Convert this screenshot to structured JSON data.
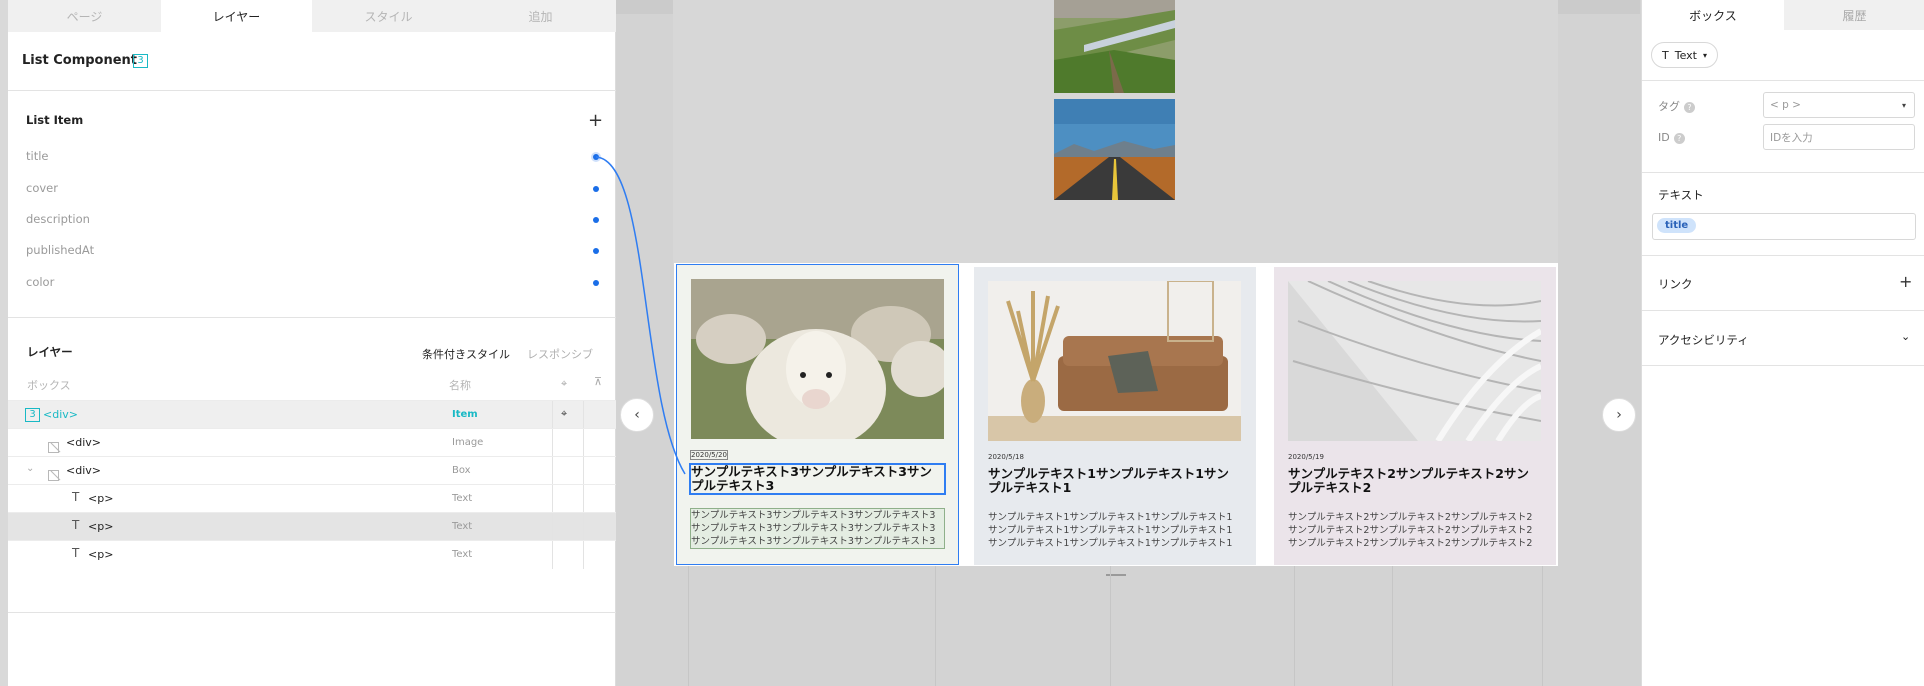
{
  "left_panel": {
    "tabs": [
      "ページ",
      "レイヤー",
      "スタイル",
      "追加"
    ],
    "component_title": "List Component",
    "component_badge": "3",
    "list_item_heading": "List Item",
    "fields": [
      "title",
      "cover",
      "description",
      "publishedAt",
      "color"
    ],
    "layers_heading": "レイヤー",
    "conditional_style": "条件付きスタイル",
    "responsive": "レスポンシブ",
    "col_box": "ボックス",
    "col_name": "名称",
    "layers": [
      {
        "badge": "3",
        "tag": "<div>",
        "type": "Item",
        "icon": "none"
      },
      {
        "tag": "<div>",
        "type": "Image",
        "icon": "image-icon"
      },
      {
        "tag": "<div>",
        "type": "Box",
        "icon": "image-icon"
      },
      {
        "tag": "<p>",
        "type": "Text",
        "icon": "text-icon"
      },
      {
        "tag": "<p>",
        "type": "Text",
        "icon": "text-icon"
      },
      {
        "tag": "<p>",
        "type": "Text",
        "icon": "text-icon"
      }
    ]
  },
  "canvas": {
    "width_label": "1330px",
    "cards": [
      {
        "date": "2020/5/20",
        "title": "サンプルテキスト3サンプルテキスト3サンプルテキスト3",
        "desc": "サンプルテキスト3サンプルテキスト3サンプルテキスト3サンプルテキスト3サンプルテキスト3サンプルテキスト3サンプルテキスト3サンプルテキスト3サンプルテキスト3",
        "bg": "#f1f3ee"
      },
      {
        "date": "2020/5/18",
        "title": "サンプルテキスト1サンプルテキスト1サンプルテキスト1",
        "desc": "サンプルテキスト1サンプルテキスト1サンプルテキスト1サンプルテキスト1サンプルテキスト1サンプルテキスト1サンプルテキスト1サンプルテキスト1サンプルテキスト1",
        "bg": "#e7eaee"
      },
      {
        "date": "2020/5/19",
        "title": "サンプルテキスト2サンプルテキスト2サンプルテキスト2",
        "desc": "サンプルテキスト2サンプルテキスト2サンプルテキスト2サンプルテキスト2サンプルテキスト2サンプルテキスト2サンプルテキスト2サンプルテキスト2サンプルテキスト2",
        "bg": "#ebe4ea"
      }
    ]
  },
  "right_panel": {
    "tabs": [
      "ボックス",
      "履歴"
    ],
    "element_type": "Text",
    "tag_label": "タグ",
    "tag_value": "< p >",
    "id_label": "ID",
    "id_placeholder": "IDを入力",
    "text_heading": "テキスト",
    "text_binding": "title",
    "link_heading": "リンク",
    "a11y_heading": "アクセシビリティ"
  },
  "colors": {
    "accent": "#1a6ee8",
    "teal": "#19b9c5"
  }
}
